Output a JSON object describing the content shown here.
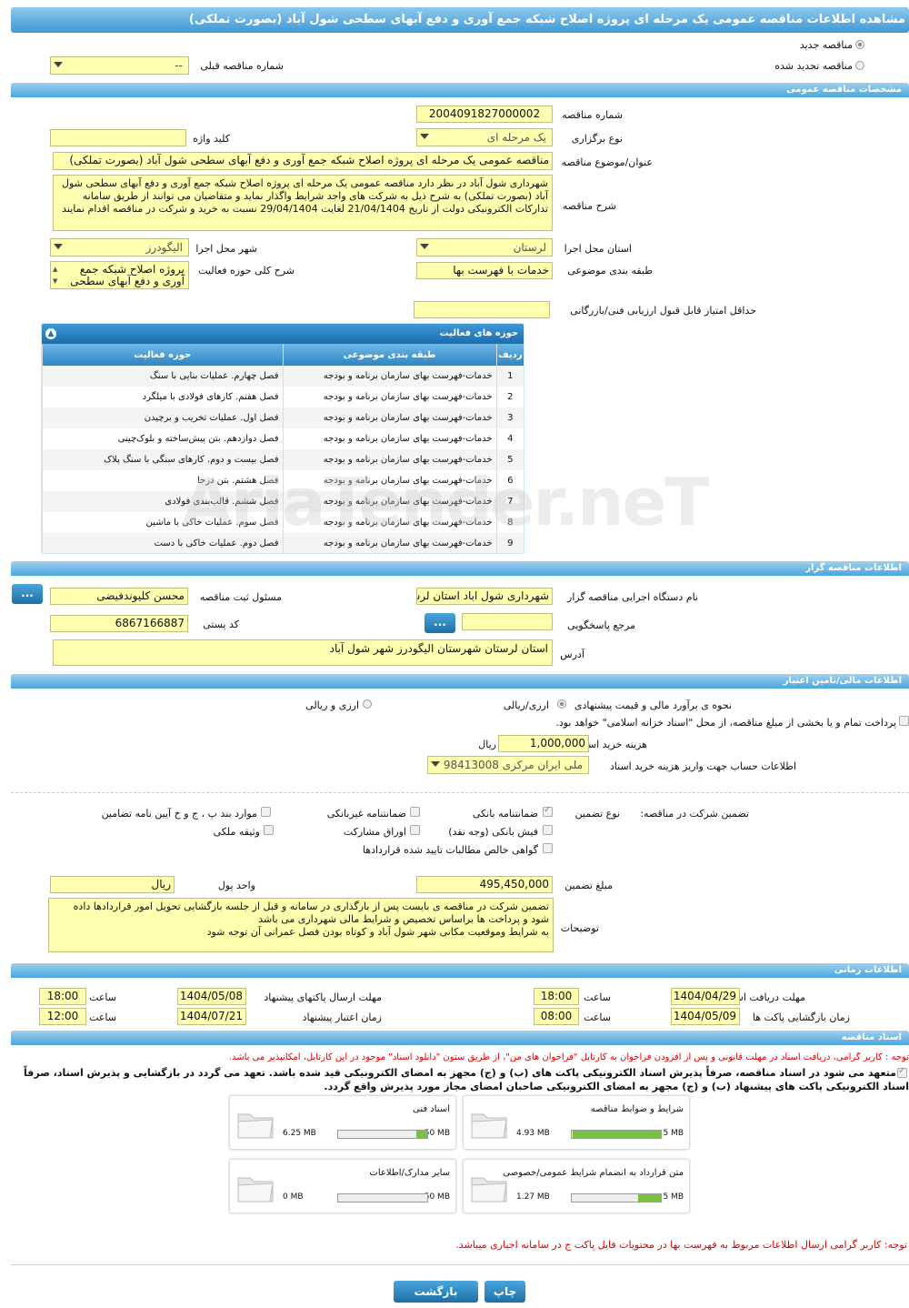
{
  "page": {
    "title": "مشاهده اطلاعات مناقصه عمومی یک مرحله ای پروژه اصلاح شبکه جمع آوری و دفع آبهای سطحی شول آباد (بصورت تملکی)"
  },
  "top": {
    "new_tender": "مناقصه جدید",
    "renewed_tender": "مناقصه تجدید شده",
    "prev_tender_label": "شماره مناقصه قبلی",
    "prev_tender_value": "--"
  },
  "general": {
    "header": "مشخصات مناقصه عمومی",
    "tender_no_label": "شماره مناقصه",
    "tender_no": "2004091827000002",
    "type_label": "نوع برگزاری",
    "type_value": "یک مرحله ای",
    "keyword_label": "کلید واژه",
    "keyword_value": "",
    "subject_label": "عنوان/موضوع مناقصه",
    "subject_value": "مناقصه عمومی یک مرحله ای پروژه اصلاح شبکه جمع آوری و دفع آبهای سطحی شول آباد (بصورت تملکی)",
    "desc_label": "شرح مناقصه",
    "desc_value": "شهرداری شول آباد در نظر دارد مناقصه عمومی یک مرحله ای پروژه اصلاح شبکه جمع آوری و دفع آبهای سطحی شول آباد (بصورت تملکی) به شرح ذیل به شرکت های واجد شرایط واگذار نماید و متقاضیان می توانند از طریق سامانه تدارکات الکترونیکی دولت از تاریخ 21/04/1404 لغایت 29/04/1404 نسبت به خرید و شرکت در مناقصه اقدام نمایند",
    "province_label": "استان محل اجرا",
    "province_value": "لرستان",
    "city_label": "شهر محل اجرا",
    "city_value": "الیگودرز",
    "category_label": "طبقه بندی موضوعی",
    "category_value": "خدمات با فهرست بها",
    "scope_label": "شرح کلی حوزه فعالیت",
    "scope_value": "پروژه اصلاح شبکه جمع آوری و دفع آبهای سطحی",
    "min_score_label": "حداقل امتیاز قابل قبول ارزیابی فنی/بازرگانی",
    "min_score_value": ""
  },
  "activities": {
    "title": "حوزه های فعالیت",
    "col_row": "ردیف",
    "col_cat": "طبقه بندی موضوعی",
    "col_act": "حوزه فعالیت",
    "rows": [
      {
        "n": "1",
        "cat": "خدمات-فهرست بهای سازمان برنامه و بودجه",
        "act": "فصل چهارم. عملیات بنایی با سنگ"
      },
      {
        "n": "2",
        "cat": "خدمات-فهرست بهای سازمان برنامه و بودجه",
        "act": "فصل هفتم. کارهای فولادی با میلگرد"
      },
      {
        "n": "3",
        "cat": "خدمات-فهرست بهای سازمان برنامه و بودجه",
        "act": "فصل اول. عملیات تخریب و برچیدن"
      },
      {
        "n": "4",
        "cat": "خدمات-فهرست بهای سازمان برنامه و بودجه",
        "act": "فصل دوازدهم. بتن پیش‌ساخته و بلوک‌چینی"
      },
      {
        "n": "5",
        "cat": "خدمات-فهرست بهای سازمان برنامه و بودجه",
        "act": "فصل بیست و دوم. کارهای سنگی با سنگ پلاک"
      },
      {
        "n": "6",
        "cat": "خدمات-فهرست بهای سازمان برنامه و بودجه",
        "act": "فصل هشتم. بتن درجا"
      },
      {
        "n": "7",
        "cat": "خدمات-فهرست بهای سازمان برنامه و بودجه",
        "act": "فصل ششم. قالب‌بندی فولادی"
      },
      {
        "n": "8",
        "cat": "خدمات-فهرست بهای سازمان برنامه و بودجه",
        "act": "فصل سوم. عملیات خاکی با ماشین"
      },
      {
        "n": "9",
        "cat": "خدمات-فهرست بهای سازمان برنامه و بودجه",
        "act": "فصل دوم. عملیات خاکی با دست"
      }
    ]
  },
  "organizer": {
    "header": "اطلاعات مناقصه گزار",
    "org_label": "نام دستگاه اجرایی مناقصه گزار",
    "org_value": "شهرداری شول اباد استان لرستان",
    "officer_label": "مسئول ثبت مناقصه",
    "officer_value": "محسن کلیوندفیضی",
    "more": "...",
    "ref_label": "مرجع پاسخگویی",
    "ref_value": "",
    "postal_label": "کد پستی",
    "postal_value": "6867166887",
    "address_label": "آدرس",
    "address_value": "استان لرستان شهرستان الیگودرز شهر شول آباد"
  },
  "finance": {
    "header": "اطلاعات مالی/تامین اعتبار",
    "estimate_label": "نحوه ی برآورد مالی و قیمت پیشنهادی",
    "rial_opt": "ارزی/ریالی",
    "fx_opt": "ارزی و ریالی",
    "islamic_text": "پرداخت تمام و یا بخشی از مبلغ مناقصه، از محل \"اسناد خزانه اسلامی\" خواهد بود.",
    "doc_cost_label": "هزینه خرید اسناد",
    "doc_cost_value": "1,000,000",
    "doc_cost_unit": "ریال",
    "account_label": "اطلاعات حساب جهت واریز هزینه خرید اسناد",
    "account_value": "ملی ایران مرکزی 98413008"
  },
  "guarantee": {
    "title": "تضمین شرکت در مناقصه:",
    "type_label": "نوع تضمین",
    "o1": "ضمانتنامه بانکی",
    "o2": "ضمانتنامه غیربانکی",
    "o3": "موارد بند پ ، ج و خ آیین نامه تضامین",
    "o4": "فیش بانکی (وجه نقد)",
    "o5": "اوراق مشارکت",
    "o6": "وثیقه ملکی",
    "o7": "گواهی خالص مطالبات تایید شده قراردادها",
    "amount_label": "مبلغ تضمین",
    "amount_value": "495,450,000",
    "currency_label": "واحد پول",
    "currency_value": "ریال",
    "notes_label": "توضیحات",
    "notes_value": "تضمین شرکت در مناقصه ی بایست پس از بارگذاری در سامانه و قبل از جلسه بازگشایی تحویل امور قراردادها داده شود و پرداخت ها براساس تخصیص و شرایط مالی شهرداری می باشد\nبه شرایط وموقعیت مکانی شهر شول آباد و کوتاه بودن فصل عمرانی آن توجه شود"
  },
  "timing": {
    "header": "اطلاعات زمانی",
    "receive_label": "مهلت دریافت اسناد",
    "receive_date": "1404/04/29",
    "time_label": "ساعت",
    "receive_time": "18:00",
    "send_label": "مهلت ارسال پاکتهای پیشنهاد",
    "send_date": "1404/05/08",
    "send_time": "18:00",
    "open_label": "زمان بازگشایی پاکت ها",
    "open_date": "1404/05/09",
    "open_time": "08:00",
    "valid_label": "زمان اعتبار پیشنهاد",
    "valid_date": "1404/07/21",
    "valid_time": "12:00"
  },
  "docs": {
    "header": "اسناد مناقصه",
    "note1": "توجه : کاربر گرامی، دریافت اسناد در مهلت قانونی و پس از افزودن فراخوان به کارتابل \"فراخوان های من\"، از طریق ستون \"دانلود اسناد\" موجود در این کارتابل، امکانپذیر می باشد.",
    "note2": "متعهد می شود در اسناد مناقصه، صرفاً پذیرش اسناد الکترونیکی پاکت های (ب) و (ج) مجهز به امضای الکترونیکی قید شده باشد. تعهد می گردد در بازگشایی و پذیرش اسناد، صرفاً اسناد الکترونیکی پاکت های پیشنهاد (ب) و (ج) مجهز به امضای الکترونیکی صاحبان امضای مجاز مورد پذیرش واقع گردد.",
    "items": [
      {
        "name": "شرایط و ضوابط مناقصه",
        "size": "4.93 MB",
        "max": "5 MB",
        "fill": 0.986
      },
      {
        "name": "اسناد فنی",
        "size": "6.25 MB",
        "max": "50 MB",
        "fill": 0.125
      },
      {
        "name": "متن قرارداد به انضمام شرایط عمومی/خصوصی",
        "size": "1.27 MB",
        "max": "5 MB",
        "fill": 0.254
      },
      {
        "name": "سایر مدارک/اطلاعات",
        "size": "0 MB",
        "max": "50 MB",
        "fill": 0
      }
    ],
    "note3": "توجه: کاربر گرامی ارسال اطلاعات مربوط به فهرست بها در محتویات فایل پاکت ج در سامانه اجباری میباشد."
  },
  "footer": {
    "print": "چاپ",
    "back": "بازگشت"
  }
}
